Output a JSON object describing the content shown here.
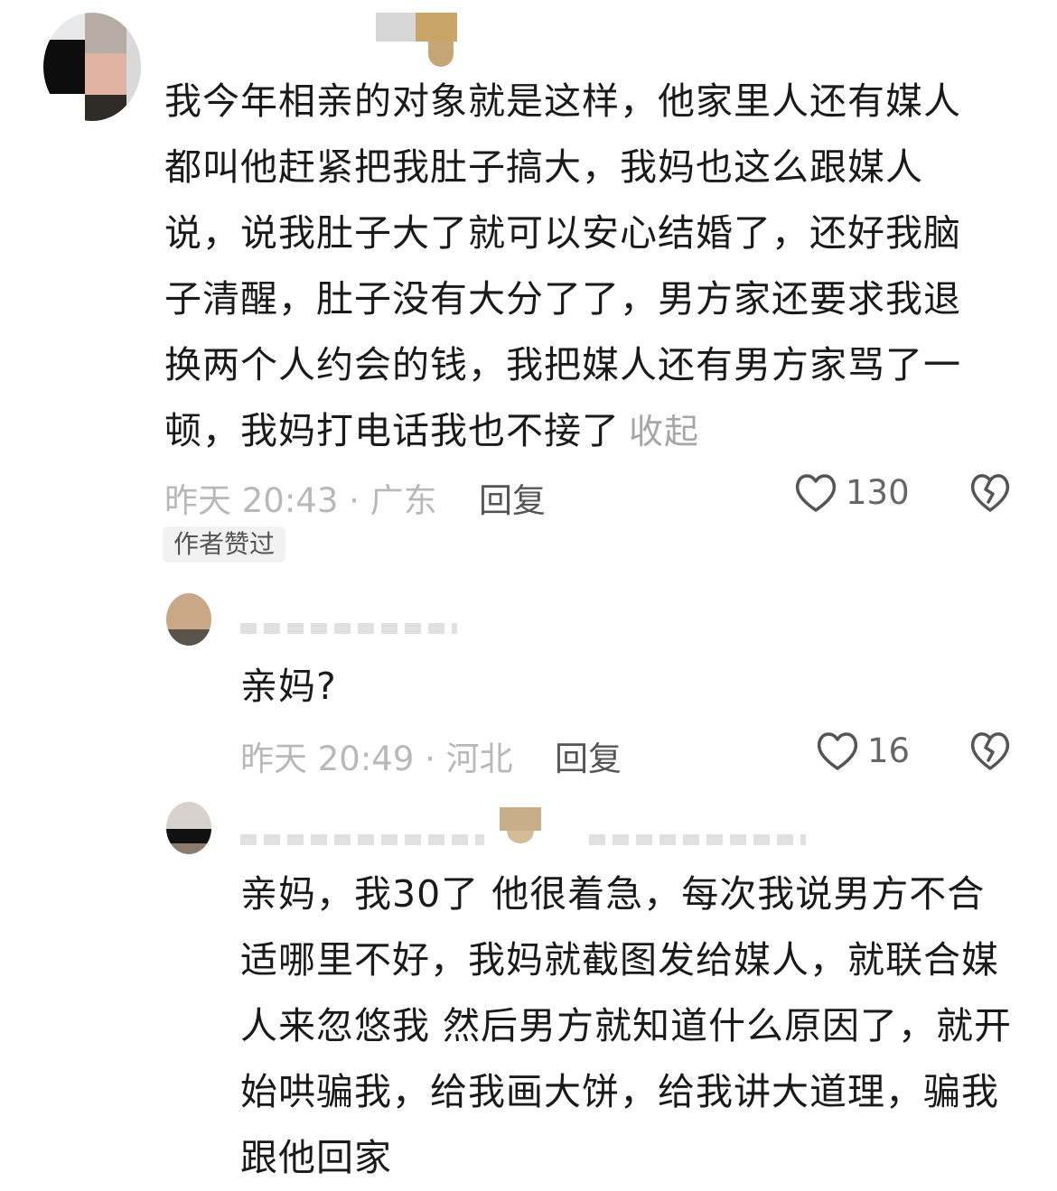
{
  "comment_main": {
    "text": "我今年相亲的对象就是这样，他家里人还有媒人都叫他赶紧把我肚子搞大，我妈也这么跟媒人说，说我肚子大了就可以安心结婚了，还好我脑子清醒，肚子没有大分了了，男方家还要求我退换两个人约会的钱，我把媒人还有男方家骂了一顿，我妈打电话我也不接了",
    "collapse_label": "收起",
    "meta": "昨天 20:43 · 广东",
    "reply_label": "回复",
    "like_count": "130",
    "badge": "作者赞过"
  },
  "reply_1": {
    "text": "亲妈?",
    "meta": "昨天 20:49 · 河北",
    "reply_label": "回复",
    "like_count": "16"
  },
  "reply_2": {
    "text": "亲妈，我30了 他很着急，每次我说男方不合适哪里不好，我妈就截图发给媒人，就联合媒人来忽悠我 然后男方就知道什么原因了，就开始哄骗我，给我画大饼，给我讲大道理，骗我跟他回家"
  },
  "icons": {
    "like": "heart-outline-icon",
    "dislike": "broken-heart-icon"
  },
  "colors": {
    "text": "#1a1a1a",
    "meta": "#b8b8b8",
    "reply": "#555555",
    "badge_bg": "#f2f2f2"
  }
}
